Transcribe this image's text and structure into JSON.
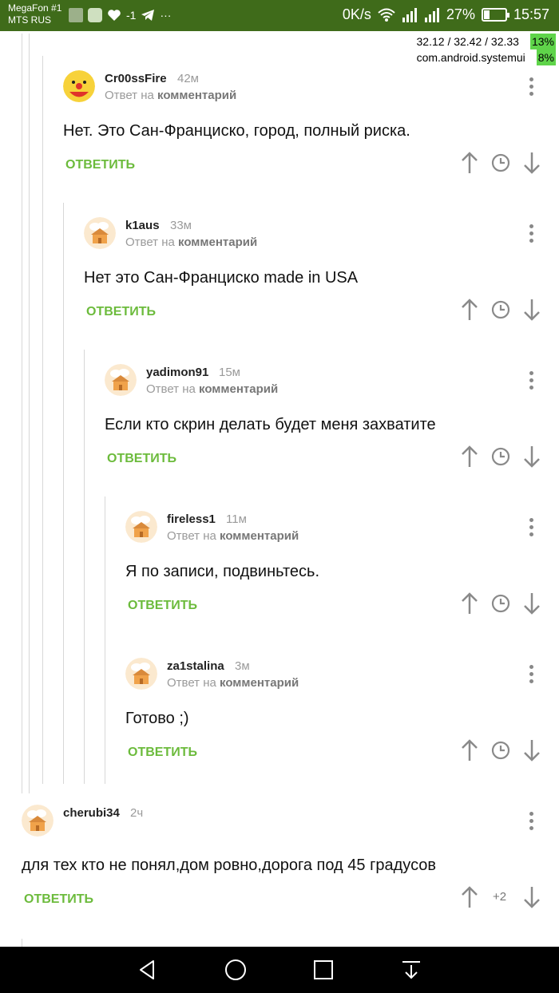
{
  "status_bar": {
    "carrier_1": "MegaFon #1",
    "carrier_2": "MTS RUS",
    "signal_label": "-1",
    "more_label": "···",
    "network_speed": "0K/s",
    "battery_percent": "27%",
    "battery_level": 0.27,
    "time": "15:57",
    "bg_color": "#3f6b1a"
  },
  "overlay": {
    "load": "32.12 / 32.42 / 32.33",
    "load_pct": "13%",
    "process": "com.android.systemui",
    "process_pct": "8%"
  },
  "reply_label": "ОТВЕТИТЬ",
  "reply_to_prefix": "Ответ на",
  "reply_to_target": "комментарий",
  "comments": [
    {
      "author": "Cr00ssFire",
      "time": "42м",
      "text": "Нет. Это Сан-Франциско, город, полный риска.",
      "avatar": "clown-avatar"
    },
    {
      "author": "k1aus",
      "time": "33м",
      "text": "Нет это Сан-Франциско made in USA",
      "avatar": "house-avatar"
    },
    {
      "author": "yadimon91",
      "time": "15м",
      "text": "Если кто скрин делать будет меня захватите",
      "avatar": "house-avatar"
    },
    {
      "author": "fireless1",
      "time": "11м",
      "text": "Я по записи, подвиньтесь.",
      "avatar": "house-avatar"
    },
    {
      "author": "za1stalina",
      "time": "3м",
      "text": "Готово ;)",
      "avatar": "house-avatar"
    },
    {
      "author": "cherubi34",
      "time": "2ч",
      "text": "для тех кто не понял,дом ровно,дорога под 45 градусов",
      "avatar": "house-avatar",
      "score": "+2"
    }
  ],
  "accent_color": "#6cbb3c"
}
